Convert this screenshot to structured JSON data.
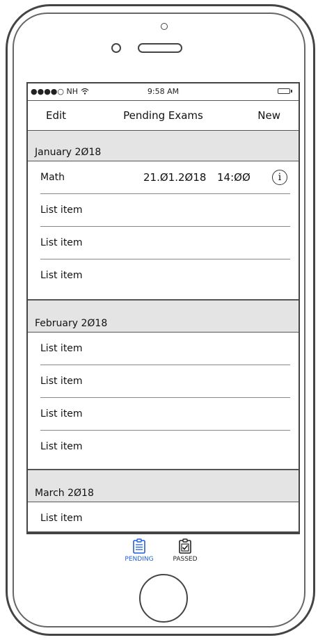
{
  "status_bar": {
    "signal": "●●●●○ NH",
    "time": "9:58 AM"
  },
  "nav": {
    "edit": "Edit",
    "title": "Pending Exams",
    "new": "New"
  },
  "sections": [
    {
      "header": "January 2Ø18",
      "items": [
        {
          "label": "Math",
          "date": "21.Ø1.2Ø18",
          "time": "14:ØØ"
        },
        {
          "label": "List item"
        },
        {
          "label": "List item"
        },
        {
          "label": "List item"
        }
      ]
    },
    {
      "header": "February 2Ø18",
      "items": [
        {
          "label": "List item"
        },
        {
          "label": "List item"
        },
        {
          "label": "List item"
        },
        {
          "label": "List item"
        }
      ]
    },
    {
      "header": "March 2Ø18",
      "items": [
        {
          "label": "List item"
        }
      ]
    }
  ],
  "tabs": {
    "pending": "PENDING",
    "passed": "PASSED",
    "active_color": "#1f5fd6"
  },
  "icons": {
    "info": "info-icon",
    "pending": "clipboard-list-icon",
    "passed": "clipboard-check-icon"
  }
}
